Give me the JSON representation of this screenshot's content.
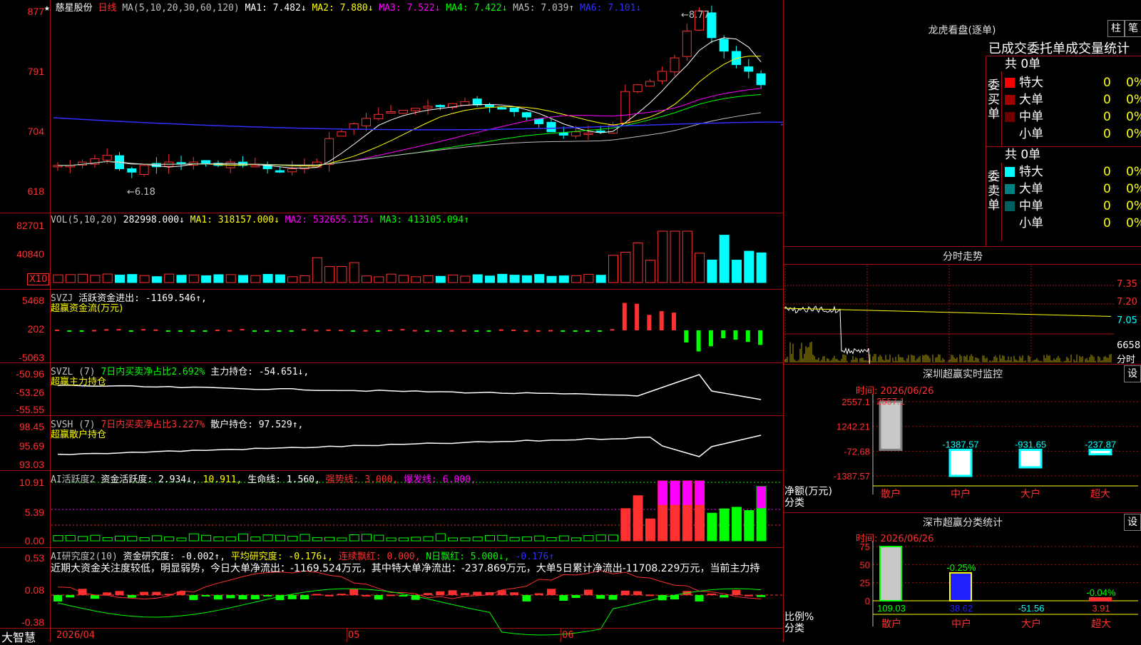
{
  "stock": {
    "star": "★",
    "name": "慈星股份",
    "period": "日线"
  },
  "colors": {
    "up": "#ff3030",
    "down": "#00ffff",
    "bg": "#000000",
    "grid": "#a01010",
    "ma1": "#ffffff",
    "ma2": "#ffff00",
    "ma3": "#ff00ff",
    "ma4": "#00ff00",
    "ma5": "#c0c0c0",
    "ma6": "#3030ff"
  },
  "main": {
    "ma_label": "MA(5,10,20,30,60,120)",
    "ma1": "MA1: 7.482↓",
    "ma2": "MA2: 7.880↓",
    "ma3": "MA3: 7.522↓",
    "ma4": "MA4: 7.422↓",
    "ma5": "MA5: 7.039↑",
    "ma6": "MA6: 7.101↓",
    "axis": [
      "877",
      "791",
      "704",
      "618"
    ],
    "high_mark": "8.77",
    "low_mark": "6.18"
  },
  "vol": {
    "label": "VOL(5,10,20)",
    "v": "282998.000↓",
    "ma1": "MA1: 318157.000↓",
    "ma2": "MA2: 532655.125↓",
    "ma3": "MA3: 413105.094↑",
    "axis": [
      "82701",
      "40840"
    ],
    "unit": "X10"
  },
  "svzj": {
    "label": "SVZJ",
    "l1": "活跃资金进出: -1169.546↑,",
    "l2": "超赢资金流(万元)",
    "axis": [
      "5468",
      "202",
      "-5063"
    ]
  },
  "svzl": {
    "label": "SVZL (7)",
    "l1": "7日内买卖净占比2.692%",
    "l2": "主力持仓: -54.651↓,",
    "l3": "超赢主力持仓",
    "axis": [
      "-50.96",
      "-53.26",
      "-55.55"
    ]
  },
  "svsh": {
    "label": "SVSH (7)",
    "l1": "7日内买卖净占比3.227%",
    "l2": "散户持仓: 97.529↑,",
    "l3": "超赢散户持仓",
    "axis": [
      "98.45",
      "95.69",
      "93.03"
    ]
  },
  "ai1": {
    "label": "AI活跃度2",
    "l1": "资金活跃度: 2.934↓,",
    "l2": "10.911,",
    "l3": "生命线: 1.560,",
    "l4": "强势线: 3.000,",
    "l5": "爆发线: 6.000,",
    "axis": [
      "10.91",
      "5.39",
      "0.00"
    ]
  },
  "ai2": {
    "label": "AI研究度2(10)",
    "l1": "资金研究度: -0.002↑,",
    "l2": "平均研究度: -0.176↓,",
    "l3": "连续飘红: 0.000,",
    "l4": "N日飘红: 5.000↓,",
    "l5": "-0.176↑",
    "text": "近期大资金关注度较低，明显弱势，今日大单净流出：-1169.524万元，其中特大单净流出：-237.869万元，大单5日累计净流出-11708.229万元，当前主力持",
    "axis": [
      "0.53",
      "0.08",
      "-0.38"
    ]
  },
  "footer": {
    "brand": "大智慧",
    "d1": "2026/04",
    "d2": "05",
    "d3": "06"
  },
  "dragon": {
    "title": "龙虎看盘(逐单)",
    "btn1": "柱",
    "btn2": "笔",
    "header": "已成交委托单成交量统计",
    "buy_label": "委买单",
    "sell_label": "委卖单",
    "buy_total": "共 0单",
    "sell_total": "共 0单",
    "buy": [
      {
        "name": "特大",
        "v": "0",
        "p": "0%",
        "c": "#ff0000"
      },
      {
        "name": "大单",
        "v": "0",
        "p": "0%",
        "c": "#a00000"
      },
      {
        "name": "中单",
        "v": "0",
        "p": "0%",
        "c": "#700000"
      },
      {
        "name": "小单",
        "v": "0",
        "p": "0%",
        "c": "#000000"
      }
    ],
    "sell": [
      {
        "name": "特大",
        "v": "0",
        "p": "0%",
        "c": "#00ffff"
      },
      {
        "name": "大单",
        "v": "0",
        "p": "0%",
        "c": "#008080"
      },
      {
        "name": "中单",
        "v": "0",
        "p": "0%",
        "c": "#006060"
      },
      {
        "name": "小单",
        "v": "0",
        "p": "0%",
        "c": "#000000"
      }
    ]
  },
  "fenshi": {
    "title": "分时走势",
    "axis": [
      "7.35",
      "7.20",
      "7.05"
    ],
    "vol": "6658",
    "vol_label": "分时"
  },
  "sz_monitor": {
    "title": "深圳超赢实时监控",
    "btn": "设",
    "time": "时间: 2026/06/26",
    "axis": [
      "2557.1",
      "1242.21",
      "-72.68",
      "-1387.57"
    ],
    "ylabel1": "净额(万元)",
    "ylabel2": "分类",
    "bars": [
      {
        "name": "散户",
        "v": "2557.1",
        "val": 2557.1
      },
      {
        "name": "中户",
        "v": "-1387.57",
        "val": -1387.57
      },
      {
        "name": "大户",
        "v": "-931.65",
        "val": -931.65
      },
      {
        "name": "超大",
        "v": "-237.87",
        "val": -237.87
      }
    ]
  },
  "sz_class": {
    "title": "深市超赢分类统计",
    "btn": "设",
    "time": "时间: 2026/06/26",
    "axis": [
      "75",
      "50",
      "25",
      "0"
    ],
    "ylabel1": "比例%",
    "ylabel2": "分类",
    "bars": [
      {
        "name": "散户",
        "v": "109.03",
        "val": 109.03
      },
      {
        "name": "中户",
        "v": "38.62",
        "val": 38.62,
        "top": "-0.25%"
      },
      {
        "name": "大户",
        "v": "-51.56",
        "val": -51.56
      },
      {
        "name": "超大",
        "v": "3.91",
        "val": 3.91,
        "top": "-0.04%"
      }
    ]
  }
}
